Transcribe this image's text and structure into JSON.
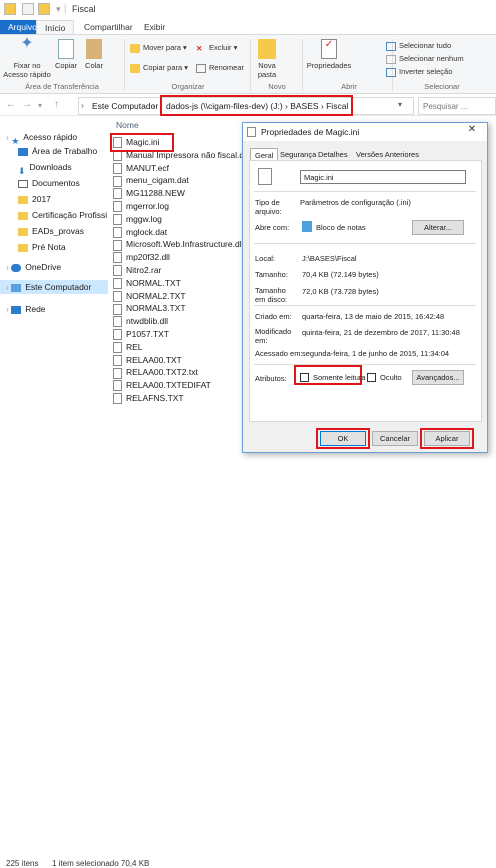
{
  "window": {
    "title": "Fiscal"
  },
  "ribbon_tabs": [
    "Arquivo",
    "Início",
    "Compartilhar",
    "Exibir"
  ],
  "ribbon": {
    "pin": "Fixar no Acesso rápido",
    "copy": "Copiar",
    "paste": "Colar",
    "move_to": "Mover para ▾",
    "copy_to": "Copiar para ▾",
    "delete": "Excluir ▾",
    "rename": "Renomear",
    "new_folder": "Nova pasta",
    "properties": "Propriedades",
    "open": "Abrir",
    "select_all": "Selecionar tudo",
    "select_none": "Selecionar nenhum",
    "invert": "Inverter seleção",
    "groups": [
      "Área de Transferência",
      "Organizar",
      "Novo",
      "Abrir",
      "Selecionar"
    ]
  },
  "address": {
    "root": "Este Computador",
    "path": "dados-js (\\\\cigam-files-dev) (J:)  ›  BASES  ›  Fiscal",
    "search_placeholder": "Pesquisar ..."
  },
  "nav": [
    {
      "label": "Acesso rápido",
      "icon": "star-icon"
    },
    {
      "label": "Área de Trabalho",
      "icon": "desktop-icon"
    },
    {
      "label": "Downloads",
      "icon": "download-icon"
    },
    {
      "label": "Documentos",
      "icon": "documents-icon"
    },
    {
      "label": "2017",
      "icon": "folder-icon"
    },
    {
      "label": "Certificação Profissi",
      "icon": "folder-icon"
    },
    {
      "label": "EADs_provas",
      "icon": "folder-icon"
    },
    {
      "label": "Pré Nota",
      "icon": "folder-icon"
    },
    {
      "label": "OneDrive",
      "icon": "cloud-icon"
    },
    {
      "label": "Este Computador",
      "icon": "computer-icon"
    },
    {
      "label": "Rede",
      "icon": "network-icon"
    }
  ],
  "files": {
    "column": "Nome",
    "items": [
      "Magic.ini",
      "Manual Impressora não fiscal.doc",
      "MANUT.ecf",
      "menu_cigam.dat",
      "MG11288.NEW",
      "mgerror.log",
      "mggw.log",
      "mglock.dat",
      "Microsoft.Web.Infrastructure.dll",
      "mp20f32.dll",
      "Nitro2.rar",
      "NORMAL.TXT",
      "NORMAL2.TXT",
      "NORMAL3.TXT",
      "ntwdblib.dll",
      "P1057.TXT",
      "REL",
      "RELAA00.TXT",
      "RELAA00.TXT2.txt",
      "RELAA00.TXTEDIFAT",
      "RELAFNS.TXT"
    ]
  },
  "status": {
    "count": "225 itens",
    "selection": "1 item selecionado 70,4 KB"
  },
  "dialog": {
    "title": "Propriedades de Magic.ini",
    "tabs": [
      "Geral",
      "Segurança",
      "Detalhes",
      "Versões Anteriores"
    ],
    "filename": "Magic.ini",
    "type_label": "Tipo de arquivo:",
    "type_value": "Parâmetros de configuração (.ini)",
    "opens_label": "Abre com:",
    "opens_value": "Bloco de notas",
    "change_btn": "Alterar...",
    "location_label": "Local:",
    "location_value": "J:\\BASES\\Fiscal",
    "size_label": "Tamanho:",
    "size_value": "70,4 KB (72.149 bytes)",
    "disk_label": "Tamanho em disco:",
    "disk_value": "72,0 KB (73.728 bytes)",
    "created_label": "Criado em:",
    "created_value": "quarta-feira, 13 de maio de 2015, 16:42:48",
    "modified_label": "Modificado em:",
    "modified_value": "quinta-feira, 21 de dezembro de 2017, 11:30:48",
    "accessed_label": "Acessado em:",
    "accessed_value": "segunda-feira, 1 de junho de 2015, 11:34:04",
    "attrs_label": "Atributos:",
    "readonly": "Somente leitura",
    "hidden": "Oculto",
    "advanced": "Avançados...",
    "ok": "OK",
    "cancel": "Cancelar",
    "apply": "Aplicar"
  }
}
